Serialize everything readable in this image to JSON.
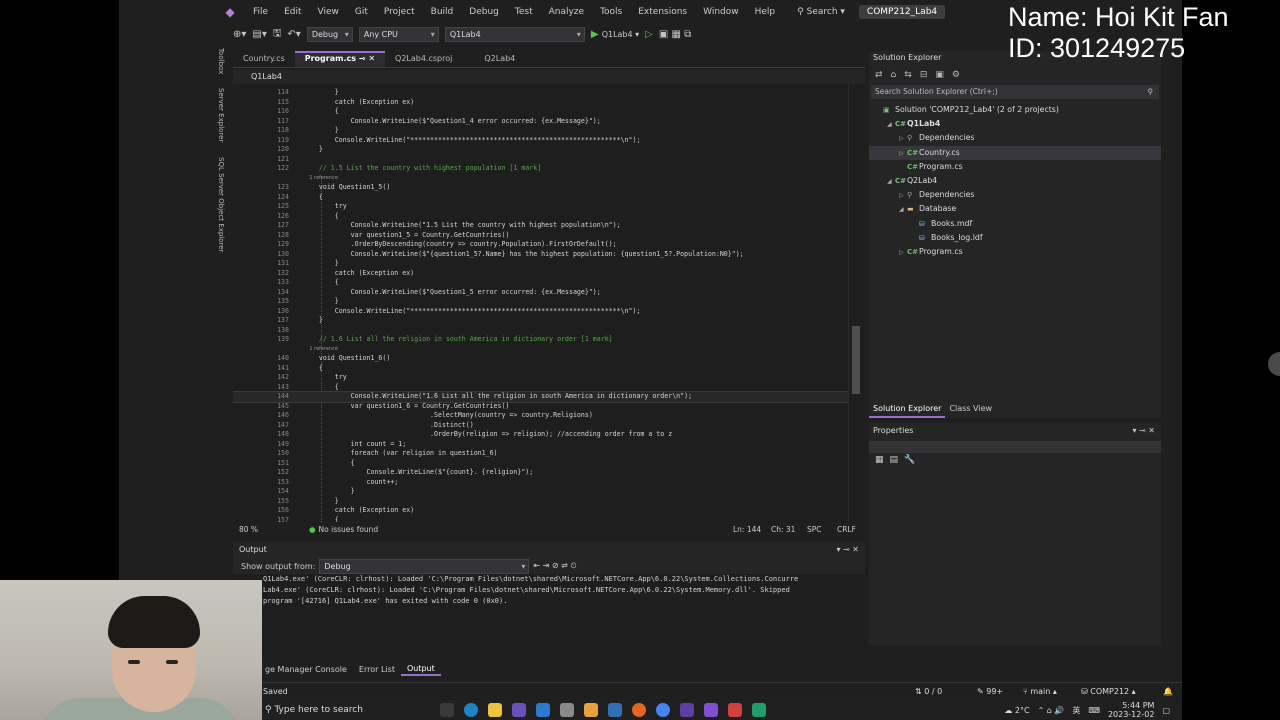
{
  "overlay": {
    "name_line": "Name: Hoi Kit Fan",
    "id_line": "ID: 301249275"
  },
  "menu": {
    "items": [
      "File",
      "Edit",
      "View",
      "Git",
      "Project",
      "Build",
      "Debug",
      "Test",
      "Analyze",
      "Tools",
      "Extensions",
      "Window",
      "Help"
    ],
    "search": "Search",
    "solution_name": "COMP212_Lab4"
  },
  "toolbar": {
    "config": "Debug",
    "platform": "Any CPU",
    "startup": "Q1Lab4",
    "run_label": "Q1Lab4"
  },
  "side_tools": [
    "Toolbox",
    "Server Explorer",
    "SQL Server Object Explorer"
  ],
  "tabs": [
    "Country.cs",
    "Program.cs",
    "Q2Lab4.csproj",
    "Q2Lab4"
  ],
  "active_tab": 1,
  "navbar": {
    "project": "Q1Lab4"
  },
  "code": [
    {
      "n": "114",
      "t": "        }"
    },
    {
      "n": "115",
      "t": "        catch (Exception ex)"
    },
    {
      "n": "116",
      "t": "        {"
    },
    {
      "n": "117",
      "t": "            Console.WriteLine($\"Question1_4 error occurred: {ex.Message}\");"
    },
    {
      "n": "118",
      "t": "        }"
    },
    {
      "n": "119",
      "t": "        Console.WriteLine(\"*****************************************************\\n\");"
    },
    {
      "n": "120",
      "t": "    }"
    },
    {
      "n": "121",
      "t": ""
    },
    {
      "n": "122",
      "t": "    // 1.5 List the country with highest population [1 mark]",
      "c": true
    },
    {
      "n": "",
      "t": "    1 reference",
      "r": true
    },
    {
      "n": "123",
      "t": "    void Question1_5()"
    },
    {
      "n": "124",
      "t": "    {"
    },
    {
      "n": "125",
      "t": "        try"
    },
    {
      "n": "126",
      "t": "        {"
    },
    {
      "n": "127",
      "t": "            Console.WriteLine(\"1.5 List the country with highest population\\n\");"
    },
    {
      "n": "128",
      "t": "            var question1_5 = Country.GetCountries()"
    },
    {
      "n": "129",
      "t": "            .OrderByDescending(country => country.Population).FirstOrDefault();"
    },
    {
      "n": "130",
      "t": "            Console.WriteLine($\"{question1_5?.Name} has the highest population: {question1_5?.Population:N0}\");"
    },
    {
      "n": "131",
      "t": "        }"
    },
    {
      "n": "132",
      "t": "        catch (Exception ex)"
    },
    {
      "n": "133",
      "t": "        {"
    },
    {
      "n": "134",
      "t": "            Console.WriteLine($\"Question1_5 error occurred: {ex.Message}\");"
    },
    {
      "n": "135",
      "t": "        }"
    },
    {
      "n": "136",
      "t": "        Console.WriteLine(\"*****************************************************\\n\");"
    },
    {
      "n": "137",
      "t": "    }"
    },
    {
      "n": "138",
      "t": ""
    },
    {
      "n": "139",
      "t": "    // 1.6 List all the religion in south America in dictionary order [1 mark]",
      "c": true
    },
    {
      "n": "",
      "t": "    1 reference",
      "r": true
    },
    {
      "n": "140",
      "t": "    void Question1_6()"
    },
    {
      "n": "141",
      "t": "    {"
    },
    {
      "n": "142",
      "t": "        try"
    },
    {
      "n": "143",
      "t": "        {"
    },
    {
      "n": "144",
      "t": "            Console.WriteLine(\"1.6 List all the religion in south America in dictionary order\\n\");",
      "cur": true
    },
    {
      "n": "145",
      "t": "            var question1_6 = Country.GetCountries()"
    },
    {
      "n": "146",
      "t": "                                .SelectMany(country => country.Religions)"
    },
    {
      "n": "147",
      "t": "                                .Distinct()"
    },
    {
      "n": "148",
      "t": "                                .OrderBy(religion => religion); //accending order from a to z"
    },
    {
      "n": "149",
      "t": "            int count = 1;"
    },
    {
      "n": "150",
      "t": "            foreach (var religion in question1_6)"
    },
    {
      "n": "151",
      "t": "            {"
    },
    {
      "n": "152",
      "t": "                Console.WriteLine($\"{count}. {religion}\");"
    },
    {
      "n": "153",
      "t": "                count++;"
    },
    {
      "n": "154",
      "t": "            }"
    },
    {
      "n": "155",
      "t": "        }"
    },
    {
      "n": "156",
      "t": "        catch (Exception ex)"
    },
    {
      "n": "157",
      "t": "        {"
    }
  ],
  "editor_status": {
    "zoom": "80 %",
    "issues": "No issues found",
    "line": "Ln: 144",
    "col": "Ch: 31",
    "spc": "SPC",
    "eol": "CRLF"
  },
  "solution_explorer": {
    "title": "Solution Explorer",
    "search_placeholder": "Search Solution Explorer (Ctrl+;)",
    "tree": [
      {
        "label": "Solution 'COMP212_Lab4' (2 of 2 projects)",
        "depth": 0,
        "icon": "solution-icon",
        "arrow": ""
      },
      {
        "label": "Q1Lab4",
        "depth": 1,
        "icon": "project-icon",
        "arrow": "◢",
        "bold": true
      },
      {
        "label": "Dependencies",
        "depth": 2,
        "icon": "dependencies-icon",
        "arrow": "▷"
      },
      {
        "label": "Country.cs",
        "depth": 2,
        "icon": "csharp-icon",
        "arrow": "▷",
        "selected": true
      },
      {
        "label": "Program.cs",
        "depth": 2,
        "icon": "csharp-icon",
        "arrow": ""
      },
      {
        "label": "Q2Lab4",
        "depth": 1,
        "icon": "project-icon",
        "arrow": "◢"
      },
      {
        "label": "Dependencies",
        "depth": 2,
        "icon": "dependencies-icon",
        "arrow": "▷"
      },
      {
        "label": "Database",
        "depth": 2,
        "icon": "folder-icon",
        "arrow": "◢"
      },
      {
        "label": "Books.mdf",
        "depth": 3,
        "icon": "database-icon",
        "arrow": ""
      },
      {
        "label": "Books_log.ldf",
        "depth": 3,
        "icon": "database-icon",
        "arrow": ""
      },
      {
        "label": "Program.cs",
        "depth": 2,
        "icon": "csharp-icon",
        "arrow": "▷"
      }
    ],
    "bottom_tabs": [
      "Solution Explorer",
      "Class View"
    ]
  },
  "properties": {
    "title": "Properties"
  },
  "output": {
    "title": "Output",
    "show_from_label": "Show output from:",
    "source": "Debug",
    "lines": [
      "Q1Lab4.exe' (CoreCLR: clrhost): Loaded 'C:\\Program Files\\dotnet\\shared\\Microsoft.NETCore.App\\6.0.22\\System.Collections.Concurre",
      "Lab4.exe' (CoreCLR: clrhost): Loaded 'C:\\Program Files\\dotnet\\shared\\Microsoft.NETCore.App\\6.0.22\\System.Memory.dll'. Skipped",
      "program '[42716] Q1Lab4.exe' has exited with code 0 (0x0)."
    ]
  },
  "bottom_tabs": [
    "ge Manager Console",
    "Error List",
    "Output"
  ],
  "status": {
    "saved": "Saved",
    "errors": "0 / 0",
    "notifications": "99+",
    "branch": "main",
    "repo": "COMP212"
  },
  "taskbar": {
    "search": "Type here to search",
    "temp": "2°C",
    "lang": "英",
    "time": "5:44 PM",
    "date": "2023-12-02"
  },
  "colors": {
    "accent": "#9d6bd4",
    "editor_bg": "#1e1e1e",
    "ide_bg": "#1f1f1f",
    "comment": "#57a64a",
    "keyword": "#569cd6"
  }
}
